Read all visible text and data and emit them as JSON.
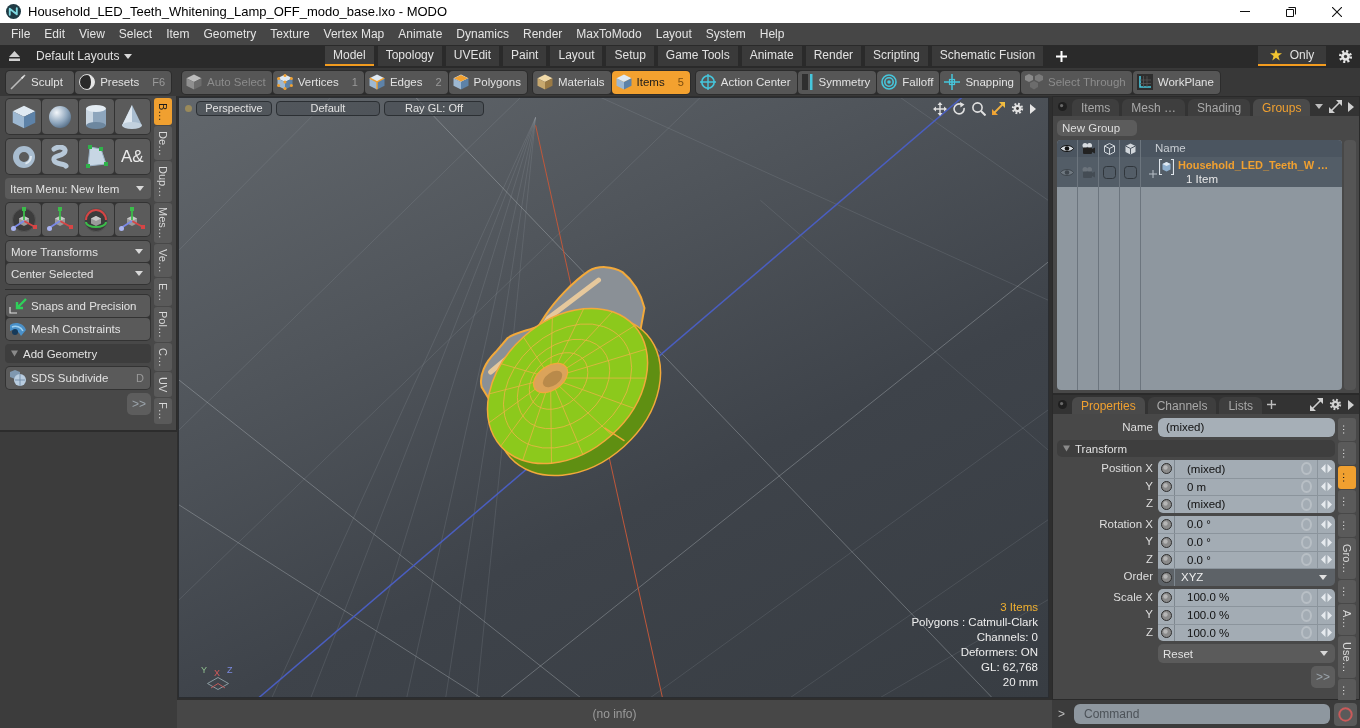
{
  "window": {
    "title": "Household_LED_Teeth_Whitening_Lamp_OFF_modo_base.lxo - MODO"
  },
  "menu": [
    "File",
    "Edit",
    "View",
    "Select",
    "Item",
    "Geometry",
    "Texture",
    "Vertex Map",
    "Animate",
    "Dynamics",
    "Render",
    "MaxToModo",
    "Layout",
    "System",
    "Help"
  ],
  "layout_bar": {
    "layouts_menu": "Default Layouts",
    "tabs": [
      {
        "label": "Model",
        "selected": true
      },
      {
        "label": "Topology",
        "selected": false
      },
      {
        "label": "UVEdit",
        "selected": false
      },
      {
        "label": "Paint",
        "selected": false
      },
      {
        "label": "Layout",
        "selected": false
      },
      {
        "label": "Setup",
        "selected": false
      },
      {
        "label": "Game Tools",
        "selected": false
      },
      {
        "label": "Animate",
        "selected": false
      },
      {
        "label": "Render",
        "selected": false
      },
      {
        "label": "Scripting",
        "selected": false
      },
      {
        "label": "Schematic Fusion",
        "selected": false
      }
    ],
    "only_toggle": {
      "label": "Only",
      "on": true
    }
  },
  "tool_row": {
    "sculpt": {
      "label": "Sculpt"
    },
    "presets": {
      "label": "Presets",
      "shortcut": "F6"
    },
    "groups": [
      {
        "buttons": [
          {
            "label": "Auto Select",
            "disabled": true,
            "selected": false
          },
          {
            "label": "Vertices",
            "shortcut": "1",
            "disabled": false,
            "selected": false
          },
          {
            "label": "Edges",
            "shortcut": "2",
            "disabled": false,
            "selected": false
          },
          {
            "label": "Polygons",
            "disabled": false,
            "selected": false
          }
        ]
      },
      {
        "buttons": [
          {
            "label": "Materials",
            "disabled": false,
            "selected": false
          },
          {
            "label": "Items",
            "shortcut": "5",
            "disabled": false,
            "selected": true
          }
        ]
      },
      {
        "buttons": [
          {
            "label": "Action Center",
            "disabled": false,
            "selected": false
          },
          {
            "label": "Symmetry",
            "disabled": false,
            "selected": false
          },
          {
            "label": "Falloff",
            "disabled": false,
            "selected": false
          },
          {
            "label": "Snapping",
            "disabled": false,
            "selected": false
          },
          {
            "label": "Select Through",
            "disabled": true,
            "selected": false
          },
          {
            "label": "WorkPlane",
            "disabled": false,
            "selected": false
          }
        ]
      }
    ]
  },
  "toolbox": {
    "text_tool_glyph": "A&",
    "item_menu": "Item Menu: New Item",
    "transform_menus": [
      "More Transforms",
      "Center Selected"
    ],
    "helpers": [
      "Snaps and Precision",
      "Mesh Constraints"
    ],
    "section": {
      "label": "Add Geometry",
      "expanded": true,
      "tools": [
        {
          "label": "SDS Subdivide",
          "shortcut": "D"
        }
      ]
    },
    "more_button": ">>",
    "side_tabs": [
      {
        "label": "B…",
        "selected": true
      },
      {
        "label": "De…",
        "selected": false
      },
      {
        "label": "Dup…",
        "selected": false
      },
      {
        "label": "Mes…",
        "selected": false
      },
      {
        "label": "Ve…",
        "selected": false
      },
      {
        "label": "E…",
        "selected": false
      },
      {
        "label": "Pol…",
        "selected": false
      },
      {
        "label": "C…",
        "selected": false
      },
      {
        "label": "UV",
        "selected": false
      },
      {
        "label": "F…",
        "selected": false
      }
    ]
  },
  "viewport": {
    "header_buttons": [
      "Perspective",
      "Default",
      "Ray GL: Off"
    ],
    "axis_labels": [
      "Y",
      "X",
      "Z"
    ],
    "info": [
      {
        "text": "3 Items",
        "kind": "count"
      },
      {
        "text": "Polygons : Catmull-Clark",
        "kind": "stat"
      },
      {
        "text": "Channels: 0",
        "kind": "stat"
      },
      {
        "text": "Deformers: ON",
        "kind": "stat"
      },
      {
        "text": "GL: 62,768",
        "kind": "stat"
      },
      {
        "text": "20 mm",
        "kind": "stat"
      }
    ]
  },
  "status_bar": {
    "text": "(no info)"
  },
  "scene_panel": {
    "tabs": [
      {
        "label": "Items",
        "selected": false
      },
      {
        "label": "Mesh …",
        "selected": false
      },
      {
        "label": "Shading",
        "selected": false
      },
      {
        "label": "Groups",
        "selected": true
      }
    ],
    "new_group_button": "New Group",
    "name_column": "Name",
    "groups": [
      {
        "name": "Household_LED_Teeth_W …",
        "count": "1 Item",
        "selected": true,
        "expanded": false,
        "visible": true,
        "render": true,
        "boxes": [
          {
            "checked": false
          },
          {
            "checked": false
          }
        ]
      }
    ]
  },
  "properties_panel": {
    "tabs": [
      {
        "label": "Properties",
        "selected": true
      },
      {
        "label": "Channels",
        "selected": false
      },
      {
        "label": "Lists",
        "selected": false
      }
    ],
    "name_field": {
      "label": "Name",
      "value": "(mixed)"
    },
    "section": {
      "label": "Transform",
      "expanded": true
    },
    "field_groups": [
      [
        {
          "label": "Position X",
          "value": "(mixed)",
          "kind": "number"
        },
        {
          "label": "Y",
          "value": "0 m",
          "kind": "number"
        },
        {
          "label": "Z",
          "value": "(mixed)",
          "kind": "number"
        }
      ],
      [
        {
          "label": "Rotation X",
          "value": "0.0 °",
          "kind": "number"
        },
        {
          "label": "Y",
          "value": "0.0 °",
          "kind": "number"
        },
        {
          "label": "Z",
          "value": "0.0 °",
          "kind": "number"
        },
        {
          "label": "Order",
          "value": "XYZ",
          "kind": "choice"
        }
      ],
      [
        {
          "label": "Scale X",
          "value": "100.0 %",
          "kind": "number"
        },
        {
          "label": "Y",
          "value": "100.0 %",
          "kind": "number"
        },
        {
          "label": "Z",
          "value": "100.0 %",
          "kind": "number"
        }
      ]
    ],
    "reset_menu": "Reset",
    "more_button": ">>",
    "side_tabs": [
      {
        "label": "…",
        "selected": false
      },
      {
        "label": "…",
        "selected": false
      },
      {
        "label": "…",
        "selected": true
      },
      {
        "label": "…",
        "selected": false
      },
      {
        "label": "…",
        "selected": false
      },
      {
        "label": "Gro…",
        "selected": false
      },
      {
        "label": "…",
        "selected": false
      },
      {
        "label": "A…",
        "selected": false
      },
      {
        "label": "Use…",
        "selected": false
      },
      {
        "label": "…",
        "selected": false
      }
    ]
  },
  "command_bar": {
    "prompt": ">",
    "placeholder": "Command"
  }
}
